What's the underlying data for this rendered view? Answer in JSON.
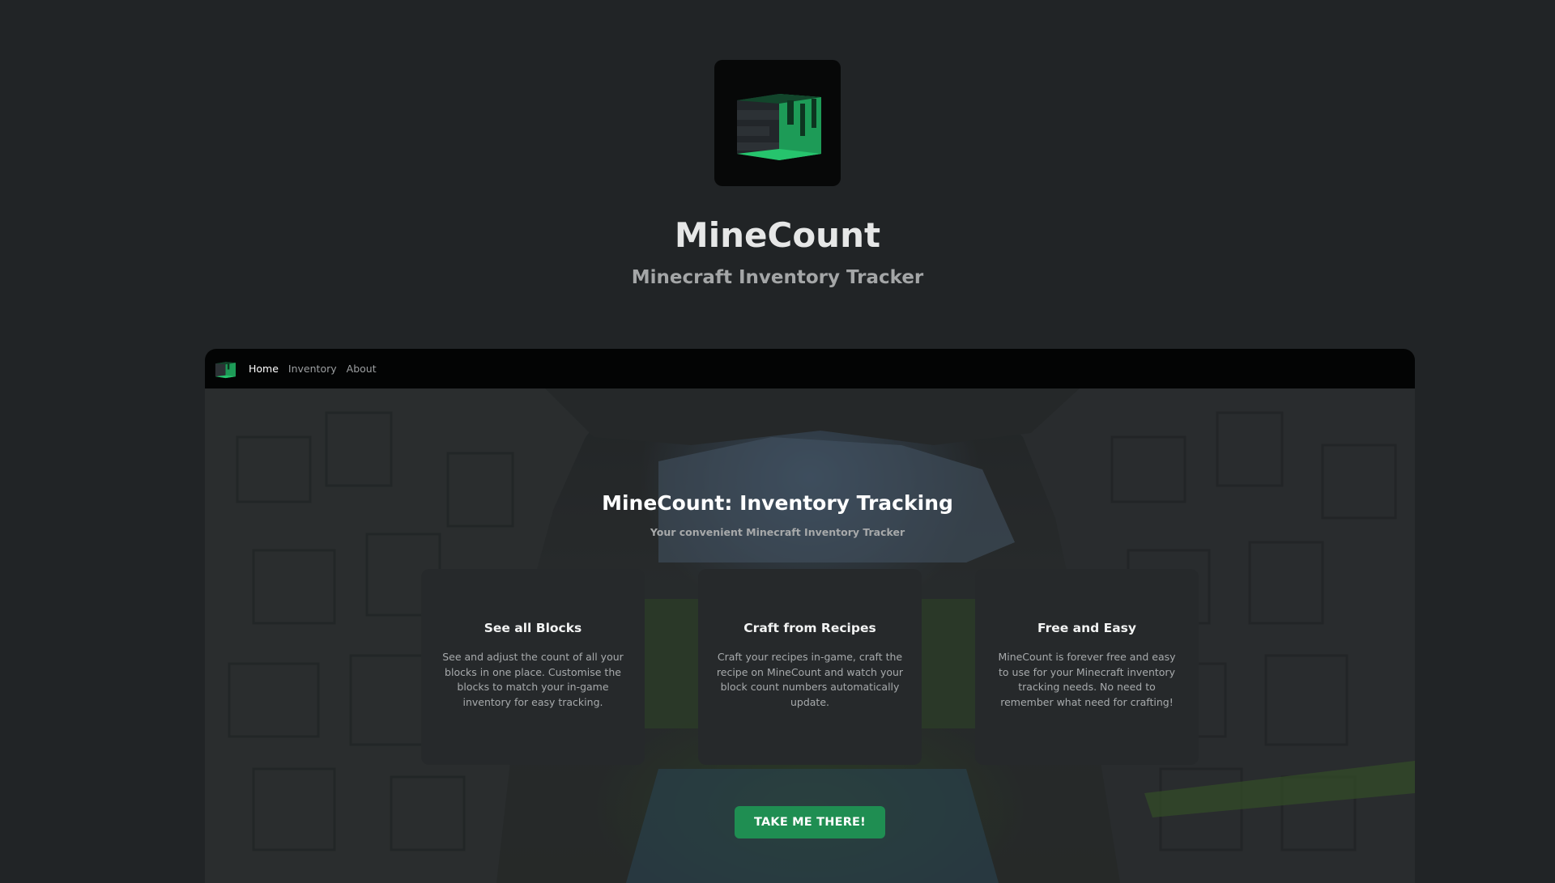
{
  "hero": {
    "title": "MineCount",
    "subtitle": "Minecraft Inventory Tracker",
    "logo_icon": "minecount-cube-logo-icon"
  },
  "navbar": {
    "logo_icon": "minecount-cube-logo-icon",
    "links": [
      {
        "label": "Home",
        "active": true
      },
      {
        "label": "Inventory",
        "active": false
      },
      {
        "label": "About",
        "active": false
      }
    ]
  },
  "main": {
    "heading": "MineCount: Inventory Tracking",
    "subheading": "Your convenient Minecraft Inventory Tracker",
    "cards": [
      {
        "title": "See all Blocks",
        "body": "See and adjust the count of all your blocks in one place. Customise the blocks to match your in-game inventory for easy tracking."
      },
      {
        "title": "Craft from Recipes",
        "body": "Craft your recipes in-game, craft the recipe on MineCount and watch your block count numbers automatically update."
      },
      {
        "title": "Free and Easy",
        "body": "MineCount is forever free and easy to use for your Minecraft inventory tracking needs. No need to remember what need for crafting!"
      }
    ],
    "cta_label": "TAKE ME THERE!"
  },
  "colors": {
    "page_background": "#212426",
    "accent_green": "#1f8e52",
    "navbar_background": "#030404",
    "card_background": "#26292b"
  }
}
